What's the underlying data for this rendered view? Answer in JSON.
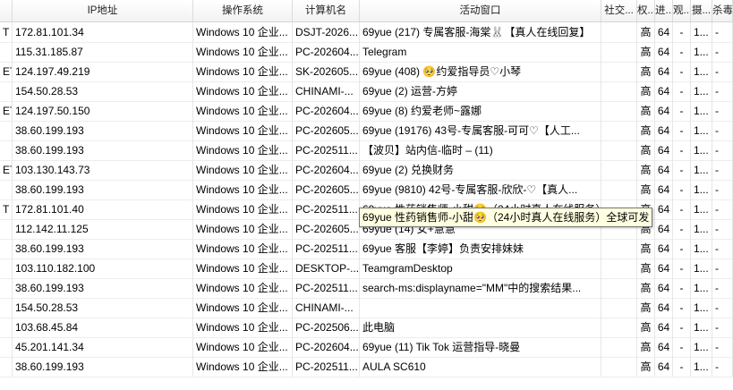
{
  "columns": [
    {
      "key": "c0",
      "label": ""
    },
    {
      "key": "ip",
      "label": "IP地址"
    },
    {
      "key": "os",
      "label": "操作系统"
    },
    {
      "key": "pc",
      "label": "计算机名"
    },
    {
      "key": "win",
      "label": "活动窗口"
    },
    {
      "key": "social",
      "label": "社交..."
    },
    {
      "key": "perm",
      "label": "权..."
    },
    {
      "key": "proc",
      "label": "进..."
    },
    {
      "key": "view",
      "label": "观..."
    },
    {
      "key": "cam",
      "label": "摄..."
    },
    {
      "key": "av",
      "label": "杀毒"
    }
  ],
  "rows": [
    {
      "c0": "T",
      "ip": "172.81.101.34",
      "os": "Windows 10 企业...",
      "pc": "DSJT-2026...",
      "win": "69yue (217) 专属客服-海棠🐰【真人在线回复】",
      "social": "",
      "perm": "高",
      "proc": "64",
      "view": "-",
      "cam": "1...",
      "av": "-"
    },
    {
      "c0": "",
      "ip": "115.31.185.87",
      "os": "Windows 10 企业...",
      "pc": "PC-202604...",
      "win": "Telegram",
      "social": "",
      "perm": "高",
      "proc": "64",
      "view": "-",
      "cam": "1...",
      "av": "-"
    },
    {
      "c0": "ET",
      "ip": "124.197.49.219",
      "os": "Windows 10 企业...",
      "pc": "SK-202605...",
      "win": "69yue (408) 🥺约爱指导员♡小琴",
      "social": "",
      "perm": "高",
      "proc": "64",
      "view": "-",
      "cam": "1...",
      "av": "-"
    },
    {
      "c0": "",
      "ip": "154.50.28.53",
      "os": "Windows 10 企业...",
      "pc": "CHINAMI-...",
      "win": "69yue (2) 运营-方婷",
      "social": "",
      "perm": "高",
      "proc": "64",
      "view": "-",
      "cam": "1...",
      "av": "-"
    },
    {
      "c0": "ET",
      "ip": "124.197.50.150",
      "os": "Windows 10 企业...",
      "pc": "PC-202604...",
      "win": "69yue (8) 约爱老师~露娜",
      "social": "",
      "perm": "高",
      "proc": "64",
      "view": "-",
      "cam": "1...",
      "av": "-"
    },
    {
      "c0": "",
      "ip": "38.60.199.193",
      "os": "Windows 10 企业...",
      "pc": "PC-202605...",
      "win": "69yue (19176) 43号-专属客服-可可♡【人工...",
      "social": "",
      "perm": "高",
      "proc": "64",
      "view": "-",
      "cam": "1...",
      "av": "-"
    },
    {
      "c0": "",
      "ip": "38.60.199.193",
      "os": "Windows 10 企业...",
      "pc": "PC-202511...",
      "win": "【波贝】站内信-临时 – (11)",
      "social": "",
      "perm": "高",
      "proc": "64",
      "view": "-",
      "cam": "1...",
      "av": "-"
    },
    {
      "c0": "ET",
      "ip": "103.130.143.73",
      "os": "Windows 10 企业...",
      "pc": "PC-202604...",
      "win": "69yue (2) 兑换财务",
      "social": "",
      "perm": "高",
      "proc": "64",
      "view": "-",
      "cam": "1...",
      "av": "-"
    },
    {
      "c0": "",
      "ip": "38.60.199.193",
      "os": "Windows 10 企业...",
      "pc": "PC-202605...",
      "win": "69yue (9810) 42号-专属客服-欣欣-♡【真人...",
      "social": "",
      "perm": "高",
      "proc": "64",
      "view": "-",
      "cam": "1...",
      "av": "-"
    },
    {
      "c0": "T",
      "ip": "172.81.101.40",
      "os": "Windows 10 企业...",
      "pc": "PC-202511...",
      "win": "69yue  性药销售师-小甜🥺（24小时真人在线服务）全球可发",
      "social": "",
      "perm": "高",
      "proc": "64",
      "view": "-",
      "cam": "1...",
      "av": "-"
    },
    {
      "c0": "",
      "ip": "112.142.11.125",
      "os": "Windows 10 企业...",
      "pc": "PC-202605...",
      "win": "69yue (14) 女+慧慧",
      "social": "",
      "perm": "高",
      "proc": "64",
      "view": "-",
      "cam": "1...",
      "av": "-"
    },
    {
      "c0": "",
      "ip": "38.60.199.193",
      "os": "Windows 10 企业...",
      "pc": "PC-202511...",
      "win": "69yue  客服【李婷】负责安排妹妹",
      "social": "",
      "perm": "高",
      "proc": "64",
      "view": "-",
      "cam": "1...",
      "av": "-"
    },
    {
      "c0": "",
      "ip": "103.110.182.100",
      "os": "Windows 10 企业...",
      "pc": "DESKTOP-...",
      "win": "TeamgramDesktop",
      "social": "",
      "perm": "高",
      "proc": "64",
      "view": "-",
      "cam": "1...",
      "av": "-"
    },
    {
      "c0": "",
      "ip": "38.60.199.193",
      "os": "Windows 10 企业...",
      "pc": "PC-202511...",
      "win": "search-ms:displayname=\"MM\"中的搜索结果...",
      "social": "",
      "perm": "高",
      "proc": "64",
      "view": "-",
      "cam": "1...",
      "av": "-"
    },
    {
      "c0": "",
      "ip": "154.50.28.53",
      "os": "Windows 10 企业...",
      "pc": "CHINAMI-...",
      "win": "",
      "social": "",
      "perm": "高",
      "proc": "64",
      "view": "-",
      "cam": "1...",
      "av": "-"
    },
    {
      "c0": "",
      "ip": "103.68.45.84",
      "os": "Windows 10 企业...",
      "pc": "PC-202506...",
      "win": "此电脑",
      "social": "",
      "perm": "高",
      "proc": "64",
      "view": "-",
      "cam": "1...",
      "av": "-"
    },
    {
      "c0": "",
      "ip": "45.201.141.34",
      "os": "Windows 10 企业...",
      "pc": "PC-202604...",
      "win": "69yue (11) Tik Tok 运营指导-晓曼",
      "social": "",
      "perm": "高",
      "proc": "64",
      "view": "-",
      "cam": "1...",
      "av": "-"
    },
    {
      "c0": "",
      "ip": "38.60.199.193",
      "os": "Windows 10 企业...",
      "pc": "PC-202511...",
      "win": "AULA SC610",
      "social": "",
      "perm": "高",
      "proc": "64",
      "view": "-",
      "cam": "1...",
      "av": "-"
    }
  ],
  "tooltip": {
    "text": "69yue  性药销售师-小甜🥺（24小时真人在线服务）全球可发"
  }
}
